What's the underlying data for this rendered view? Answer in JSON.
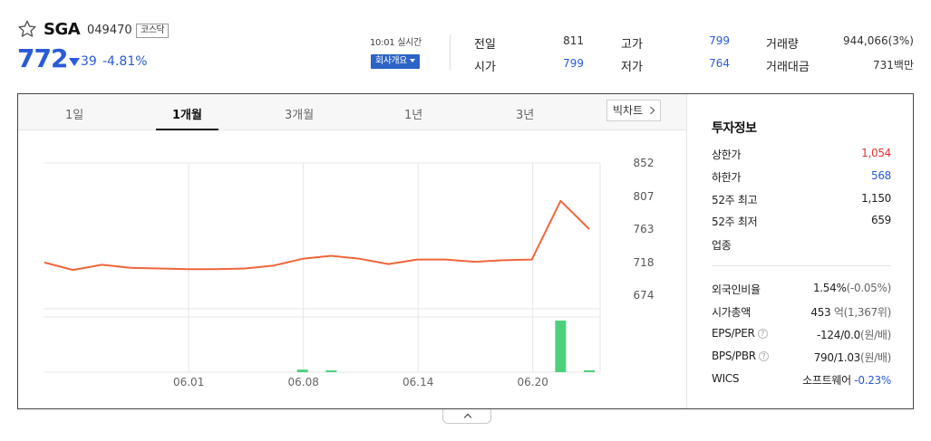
{
  "header": {
    "star_icon": "star-outline-icon",
    "name": "SGA",
    "code": "049470",
    "market": "코스닥",
    "price": "772",
    "change_value": "39",
    "change_rate": "-4.81%",
    "realtime_label": "10:01 실시간",
    "company_button": "회사개요"
  },
  "summary": {
    "prev_label": "전일",
    "prev_value": "811",
    "open_label": "시가",
    "open_value": "799",
    "high_label": "고가",
    "high_value": "799",
    "low_label": "저가",
    "low_value": "764",
    "volume_label": "거래량",
    "volume_value": "944,066(3%)",
    "amount_label": "거래대금",
    "amount_value": "731백만"
  },
  "tabs": [
    "1일",
    "1개월",
    "3개월",
    "1년",
    "3년"
  ],
  "active_tab": "1개월",
  "bigchart_label": "빅차트",
  "chart_data": {
    "type": "line",
    "y_ticks": [
      852,
      807,
      763,
      718,
      674
    ],
    "ylim": [
      674,
      852
    ],
    "x_labels": [
      "06.01",
      "06.08",
      "06.14",
      "06.20"
    ],
    "price_series": [
      718,
      708,
      715,
      711,
      710,
      709,
      709,
      710,
      714,
      723,
      727,
      723,
      716,
      722,
      722,
      719,
      721,
      722,
      801,
      763
    ],
    "volume_series": [
      0,
      0,
      0,
      0,
      0,
      0,
      0,
      0,
      0,
      0.05,
      0.01,
      0,
      0,
      0,
      0,
      0,
      0,
      0,
      1.0,
      0.03
    ],
    "line_color": "#f0663a",
    "volume_color": "#4cd07d",
    "grid": true
  },
  "sidebar": {
    "title": "투자정보",
    "limit_up_label": "상한가",
    "limit_up_value": "1,054",
    "limit_down_label": "하한가",
    "limit_down_value": "568",
    "high52_label": "52주 최고",
    "high52_value": "1,150",
    "low52_label": "52주 최저",
    "low52_value": "659",
    "industry_label": "업종",
    "foreign_label": "외국인비율",
    "foreign_value": "1.54%",
    "foreign_change": "(-0.05%)",
    "mcap_label": "시가총액",
    "mcap_value": "453",
    "mcap_unit": "억",
    "mcap_rank": "(1,367위)",
    "eps_label": "EPS/PER",
    "eps_value": "-124/0.0",
    "eps_unit": "(원/배)",
    "bps_label": "BPS/PBR",
    "bps_value": "790/1.03",
    "bps_unit": "(원/배)",
    "wics_label": "WICS",
    "wics_value": "소프트웨어",
    "wics_change": "-0.23%",
    "help_icon": "question-icon"
  },
  "colors": {
    "accent_blue": "#2a5bd7",
    "up_red": "#e0332e"
  }
}
